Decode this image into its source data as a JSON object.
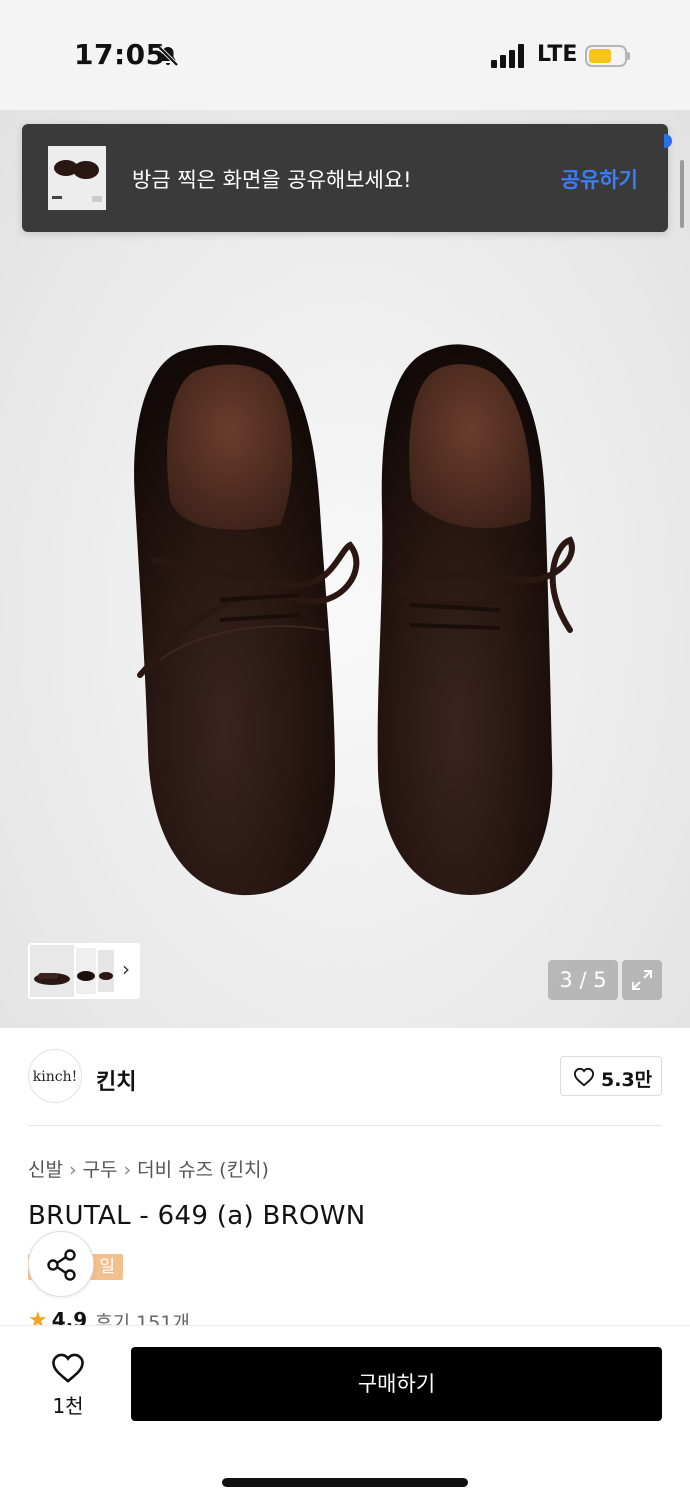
{
  "status_bar": {
    "time": "17:05",
    "network": "LTE",
    "icons": [
      "bell-muted-icon",
      "signal-icon",
      "battery-icon"
    ],
    "battery_color": "#f5c518"
  },
  "toast": {
    "message": "방금 찍은 화면을 공유해보세요!",
    "action": "공유하기",
    "action_color": "#3a7ff6"
  },
  "gallery": {
    "counter": "3 / 5",
    "icons": [
      "chevron-right-icon",
      "expand-icon"
    ]
  },
  "seller": {
    "logo_text": "kinch!",
    "name": "킨치",
    "likes": "5.3만"
  },
  "product": {
    "breadcrumb": [
      "신발",
      "구두",
      "더비 슈즈 (킨치)"
    ],
    "title": "BRUTAL - 649 (a) BROWN",
    "sale_badge": "일",
    "rating": "4.9",
    "reviews": "후기 151개",
    "badge_color": "#f2c08e"
  },
  "bottom_bar": {
    "wish_count": "1천",
    "buy_label": "구매하기"
  }
}
